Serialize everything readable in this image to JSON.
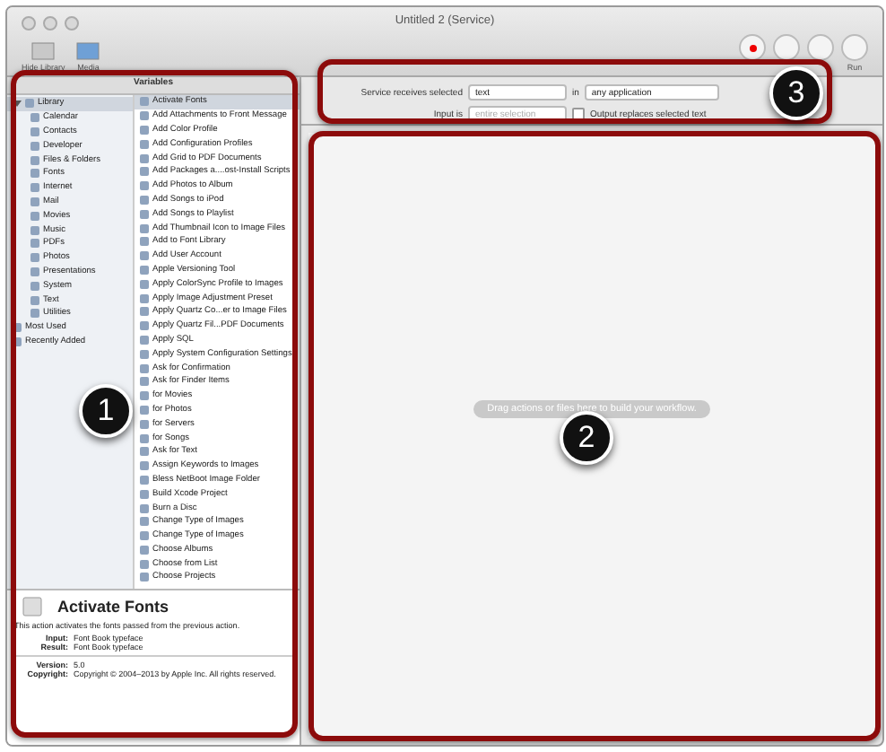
{
  "window": {
    "title": "Untitled 2 (Service)"
  },
  "toolbar": {
    "left": [
      "Hide Library",
      "Media"
    ],
    "run_label": "Run"
  },
  "library_tabs": [
    {
      "label": "Variables",
      "selected": true
    }
  ],
  "library": [
    {
      "label": "Library",
      "expanded": true,
      "selected": true,
      "children": [
        {
          "label": "Calendar"
        },
        {
          "label": "Contacts"
        },
        {
          "label": "Developer"
        },
        {
          "label": "Files & Folders"
        },
        {
          "label": "Fonts"
        },
        {
          "label": "Internet"
        },
        {
          "label": "Mail"
        },
        {
          "label": "Movies"
        },
        {
          "label": "Music"
        },
        {
          "label": "PDFs"
        },
        {
          "label": "Photos"
        },
        {
          "label": "Presentations"
        },
        {
          "label": "System"
        },
        {
          "label": "Text"
        },
        {
          "label": "Utilities"
        }
      ]
    },
    {
      "label": "Most Used"
    },
    {
      "label": "Recently Added"
    }
  ],
  "actions": [
    {
      "label": "Activate Fonts",
      "selected": true
    },
    {
      "label": "Add Attachments to Front Message",
      "selected": false
    },
    {
      "label": "Add Color Profile",
      "selected": false
    },
    {
      "label": "Add Configuration Profiles",
      "selected": false
    },
    {
      "label": "Add Grid to PDF Documents",
      "selected": false
    },
    {
      "label": "Add Packages a....ost-Install Scripts",
      "selected": false
    },
    {
      "label": "Add Photos to Album",
      "selected": false
    },
    {
      "label": "Add Songs to iPod",
      "selected": false
    },
    {
      "label": "Add Songs to Playlist",
      "selected": false
    },
    {
      "label": "Add Thumbnail Icon to Image Files",
      "selected": false
    },
    {
      "label": "Add to Font Library",
      "selected": false
    },
    {
      "label": "Add User Account",
      "selected": false
    },
    {
      "label": "Apple Versioning Tool",
      "selected": false
    },
    {
      "label": "Apply ColorSync Profile to Images",
      "selected": false
    },
    {
      "label": "Apply Image Adjustment Preset",
      "selected": false
    },
    {
      "label": "Apply Quartz Co...er to Image Files",
      "selected": false
    },
    {
      "label": "Apply Quartz Fil...PDF Documents",
      "selected": false
    },
    {
      "label": "Apply SQL",
      "selected": false
    },
    {
      "label": "Apply System Configuration Settings",
      "selected": false
    },
    {
      "label": "Ask for Confirmation",
      "selected": false
    },
    {
      "label": "Ask for Finder Items",
      "selected": false
    },
    {
      "label": "for Movies",
      "selected": false
    },
    {
      "label": "for Photos",
      "selected": false
    },
    {
      "label": "for Servers",
      "selected": false
    },
    {
      "label": "for Songs",
      "selected": false
    },
    {
      "label": "Ask for Text",
      "selected": false
    },
    {
      "label": "Assign Keywords to Images",
      "selected": false
    },
    {
      "label": "Bless NetBoot Image Folder",
      "selected": false
    },
    {
      "label": "Build Xcode Project",
      "selected": false
    },
    {
      "label": "Burn a Disc",
      "selected": false
    },
    {
      "label": "Change Type of Images",
      "selected": false
    },
    {
      "label": "Change Type of Images",
      "selected": false
    },
    {
      "label": "Choose Albums",
      "selected": false
    },
    {
      "label": "Choose from List",
      "selected": false
    },
    {
      "label": "Choose Projects",
      "selected": false
    }
  ],
  "description": {
    "title": "Activate Fonts",
    "text": "This action activates the fonts passed from the previous action.",
    "fields": [
      {
        "label": "Input:",
        "value": "Font Book typeface"
      },
      {
        "label": "Result:",
        "value": "Font Book typeface"
      }
    ],
    "meta": [
      {
        "label": "Version:",
        "value": "5.0"
      },
      {
        "label": "Copyright:",
        "value": "Copyright © 2004–2013 by Apple Inc. All rights reserved."
      }
    ]
  },
  "service": {
    "receives_label": "Service receives selected",
    "receives_value": "text",
    "in_label": "in",
    "in_value": "any application",
    "input_label": "Input is",
    "input_value": "entire selection",
    "input_disabled": true,
    "output_replaces": {
      "label": "Output replaces selected text",
      "checked": false
    }
  },
  "workflow": {
    "hint": "Drag actions or files here to build your workflow."
  },
  "callouts": [
    "1",
    "2",
    "3"
  ]
}
